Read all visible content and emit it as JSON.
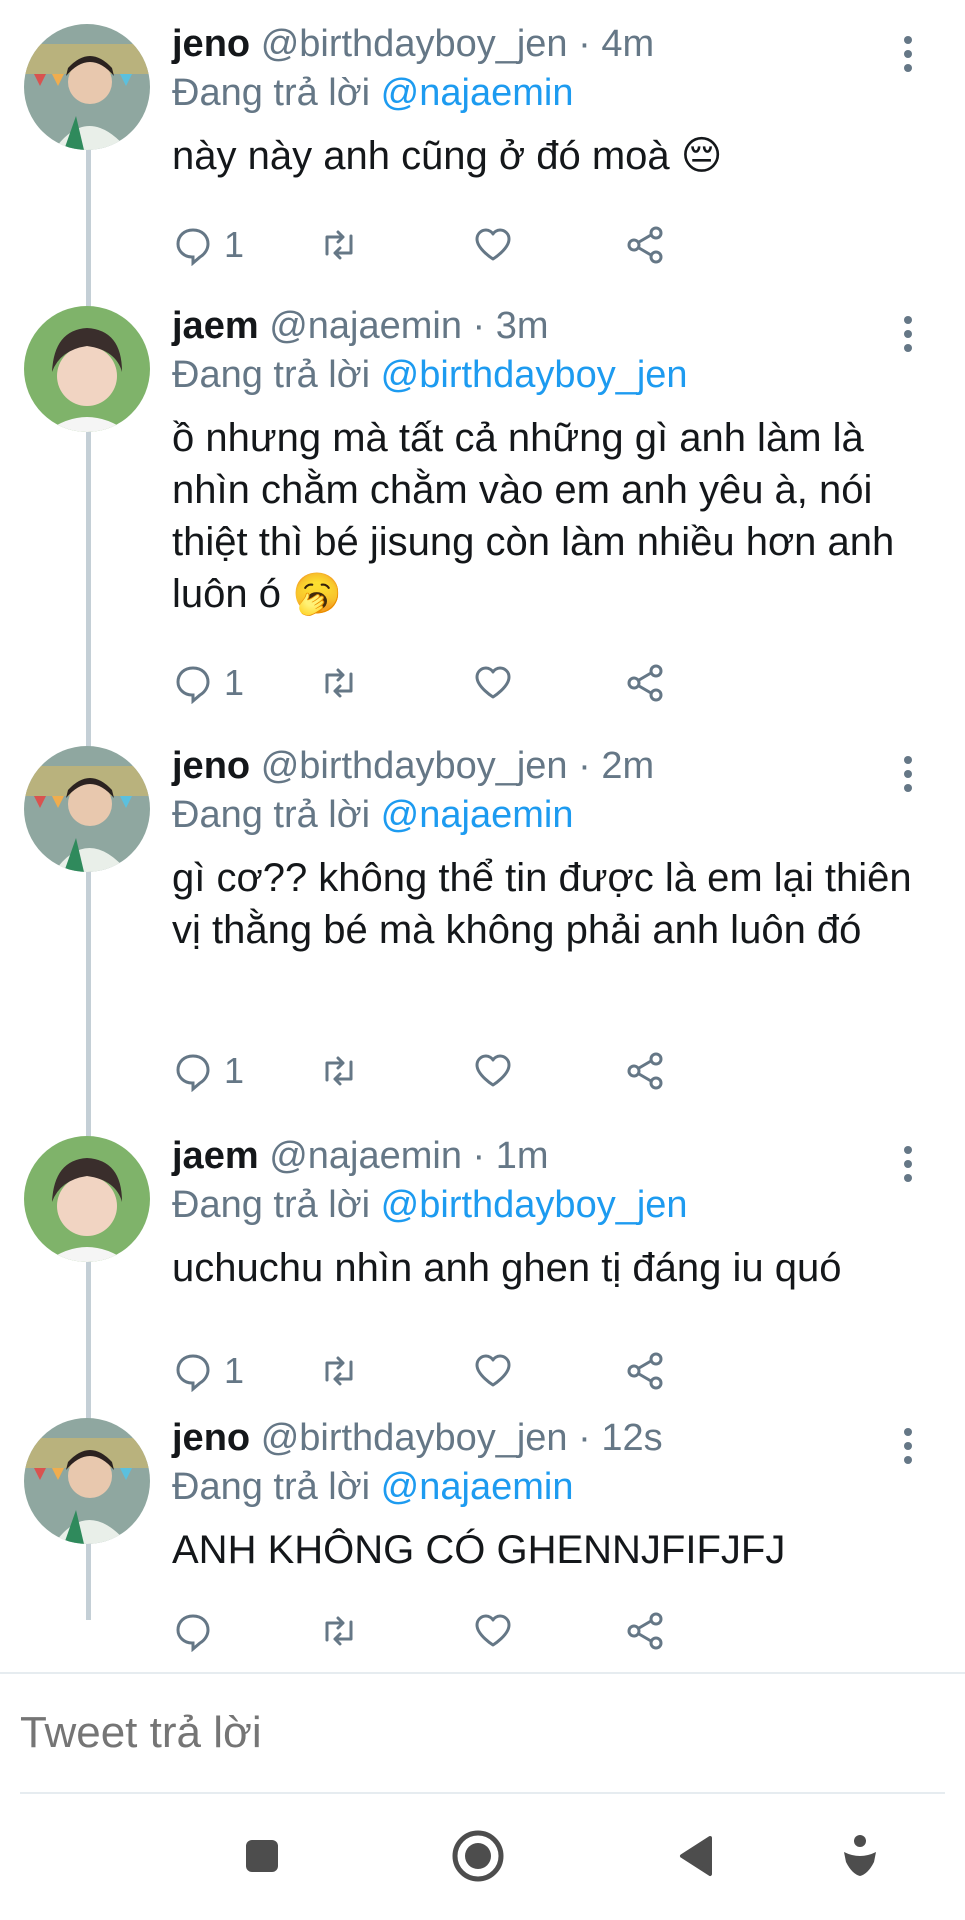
{
  "tweets": [
    {
      "name": "jeno",
      "handle": "@birthdayboy_jen",
      "time": "· 4m",
      "replying_label": "Đang trả lời",
      "replying_to": "@najaemin",
      "text": "này này anh cũng ở đó moà 😔",
      "reply_count": "1",
      "avatar": "jeno"
    },
    {
      "name": "jaem",
      "handle": "@najaemin",
      "time": "· 3m",
      "replying_label": "Đang trả lời",
      "replying_to": "@birthdayboy_jen",
      "text": "ồ nhưng mà tất cả những gì anh làm là nhìn chằm chằm vào em anh yêu à, nói thiệt thì bé jisung còn làm nhiều hơn anh luôn ó 🥱",
      "reply_count": "1",
      "avatar": "jaem"
    },
    {
      "name": "jeno",
      "handle": "@birthdayboy_jen",
      "time": "· 2m",
      "replying_label": "Đang trả lời",
      "replying_to": "@najaemin",
      "text": "gì cơ?? không thể tin được là em lại thiên vị thằng bé mà không phải anh luôn đó",
      "reply_count": "1",
      "avatar": "jeno"
    },
    {
      "name": "jaem",
      "handle": "@najaemin",
      "time": "· 1m",
      "replying_label": "Đang trả lời",
      "replying_to": "@birthdayboy_jen",
      "text": "uchuchu nhìn anh ghen tị đáng iu quó",
      "reply_count": "1",
      "avatar": "jaem"
    },
    {
      "name": "jeno",
      "handle": "@birthdayboy_jen",
      "time": "· 12s",
      "replying_label": "Đang trả lời",
      "replying_to": "@najaemin",
      "text": "ANH KHÔNG CÓ GHENNJFIFJFJ",
      "reply_count": "",
      "avatar": "jeno"
    }
  ],
  "reply_box": {
    "placeholder": "Tweet trả lời"
  },
  "icons": {
    "reply": "reply-icon",
    "retweet": "retweet-icon",
    "like": "heart-icon",
    "share": "share-icon",
    "more": "more-vert-icon",
    "nav": [
      "square-icon",
      "record-icon",
      "back-triangle-icon",
      "accessibility-icon"
    ]
  },
  "colors": {
    "accent": "#1d9bf0",
    "muted": "#657786",
    "text": "#14171a",
    "thread_line": "#c4cfd6"
  }
}
